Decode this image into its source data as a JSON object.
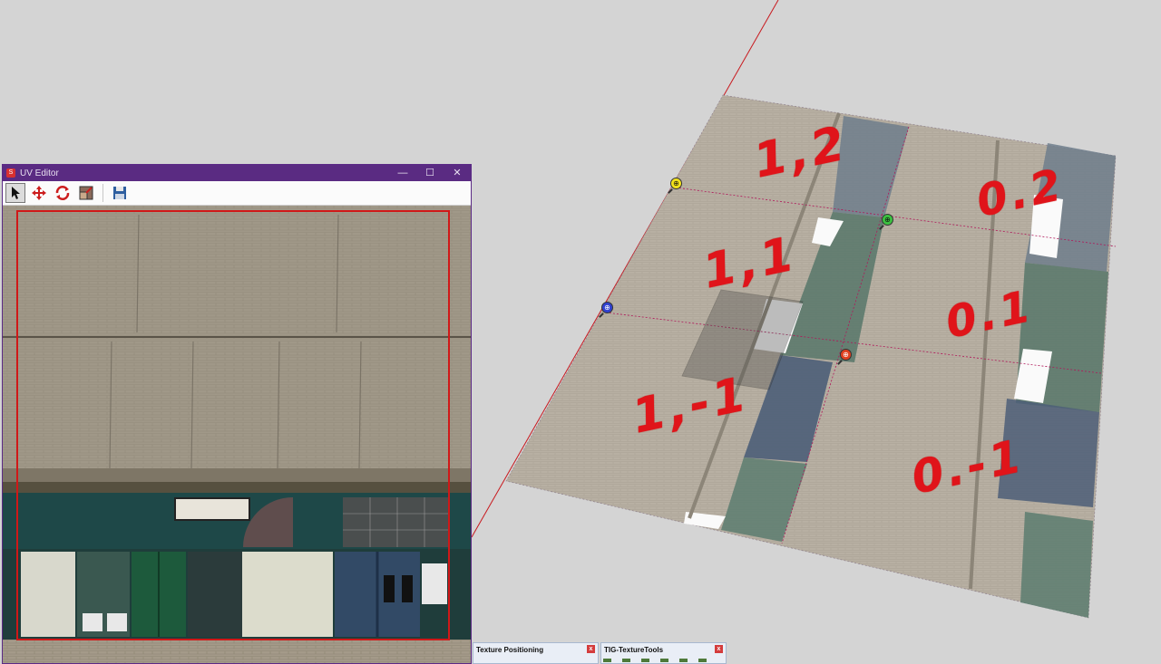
{
  "viewport": {
    "grid_labels": [
      "1,2",
      "0.2",
      "1,1",
      "0.1",
      "1,-1",
      "0.-1"
    ],
    "pins": [
      {
        "name": "yellow-pin",
        "glyph": "⊕",
        "color": "#f2e21c"
      },
      {
        "name": "green-pin",
        "glyph": "⊕",
        "color": "#3cc040"
      },
      {
        "name": "blue-pin",
        "glyph": "⊕",
        "color": "#3040d0"
      },
      {
        "name": "red-pin",
        "glyph": "⊕",
        "color": "#e04020"
      }
    ],
    "axis_color": "#c8191e",
    "label_color": "#e0141a"
  },
  "uv_editor": {
    "title": "UV Editor",
    "window_controls": {
      "minimize": "—",
      "maximize": "☐",
      "close": "✕"
    },
    "tools": [
      "select-tool-icon",
      "move-tool-icon",
      "rotate-tool-icon",
      "scale-tool-icon",
      "save-icon"
    ]
  },
  "panels": [
    {
      "title": "Texture Positioning",
      "close": "x"
    },
    {
      "title": "TIG-TextureTools",
      "close": "x"
    }
  ]
}
